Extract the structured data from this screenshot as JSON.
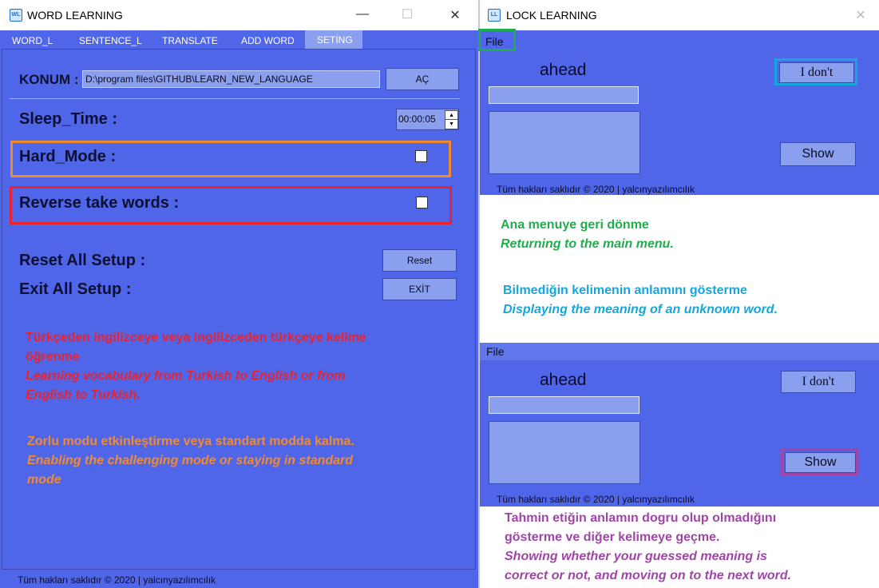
{
  "left_window": {
    "title": "WORD LEARNING",
    "controls": {
      "minimize": "—",
      "maximize": "☐",
      "close": "✕"
    },
    "tabs": [
      "WORD_L",
      "SENTENCE_L",
      "TRANSLATE",
      "ADD WORD",
      "SETİNG"
    ],
    "konum": {
      "label": "KONUM :",
      "path": "D:\\program files\\GITHUB\\LEARN_NEW_LANGUAGE",
      "button": "AÇ"
    },
    "sleep": {
      "label": "Sleep_Time :",
      "value": "00:00:05"
    },
    "hard_mode": {
      "label": "Hard_Mode :"
    },
    "reverse": {
      "label": "Reverse take words :"
    },
    "reset": {
      "label": "Reset All Setup :",
      "button": "Reset"
    },
    "exit": {
      "label": "Exit All Setup :",
      "button": "EXİT"
    },
    "note_red": {
      "line1": "Türkçeden ingilizceye veya ingilizceden türkçeye kelime",
      "line2": "öğrenme",
      "en1": "Learning vocabulary from Turkish to English or from",
      "en2": "English to Turkish."
    },
    "note_orange": {
      "tr": "Zorlu modu etkinleştirme veya standart modda kalma.",
      "en1": "Enabling the challenging mode or staying in standard",
      "en2": "mode"
    },
    "footer": "Tüm hakları saklıdır © 2020 | yalcınyazılımcılık"
  },
  "right_window": {
    "title": "LOCK LEARNING",
    "controls": {
      "close": "✕"
    },
    "top": {
      "menu": "File",
      "word": "ahead",
      "idont": "I don't",
      "show": "Show",
      "footer": "Tüm hakları saklıdır © 2020 | yalcınyazılımcılık"
    },
    "note_menu": {
      "tr": "Ana menuye geri dönme",
      "en": "Returning to the main menu."
    },
    "note_idont": {
      "tr": "Bilmediğin kelimenin anlamını gösterme",
      "en": "Displaying the meaning of an unknown word."
    },
    "bottom": {
      "menu": "File",
      "word": "ahead",
      "idont": "I don't",
      "show": "Show",
      "footer": "Tüm hakları saklıdır © 2020 | yalcınyazılımcılık"
    },
    "note_show": {
      "tr1": "Tahmin etiğin anlamın dogru olup olmadığını",
      "tr2": "gösterme ve diğer kelimeye geçme.",
      "en1": "Showing whether your guessed meaning is",
      "en2": "correct or not, and moving on to the next word."
    }
  },
  "colors": {
    "panel": "#5066e9",
    "red": "#e8222f",
    "orange": "#f28a2e",
    "green": "#1fae4b",
    "blue": "#17a6d9",
    "purple": "#a045a8"
  }
}
